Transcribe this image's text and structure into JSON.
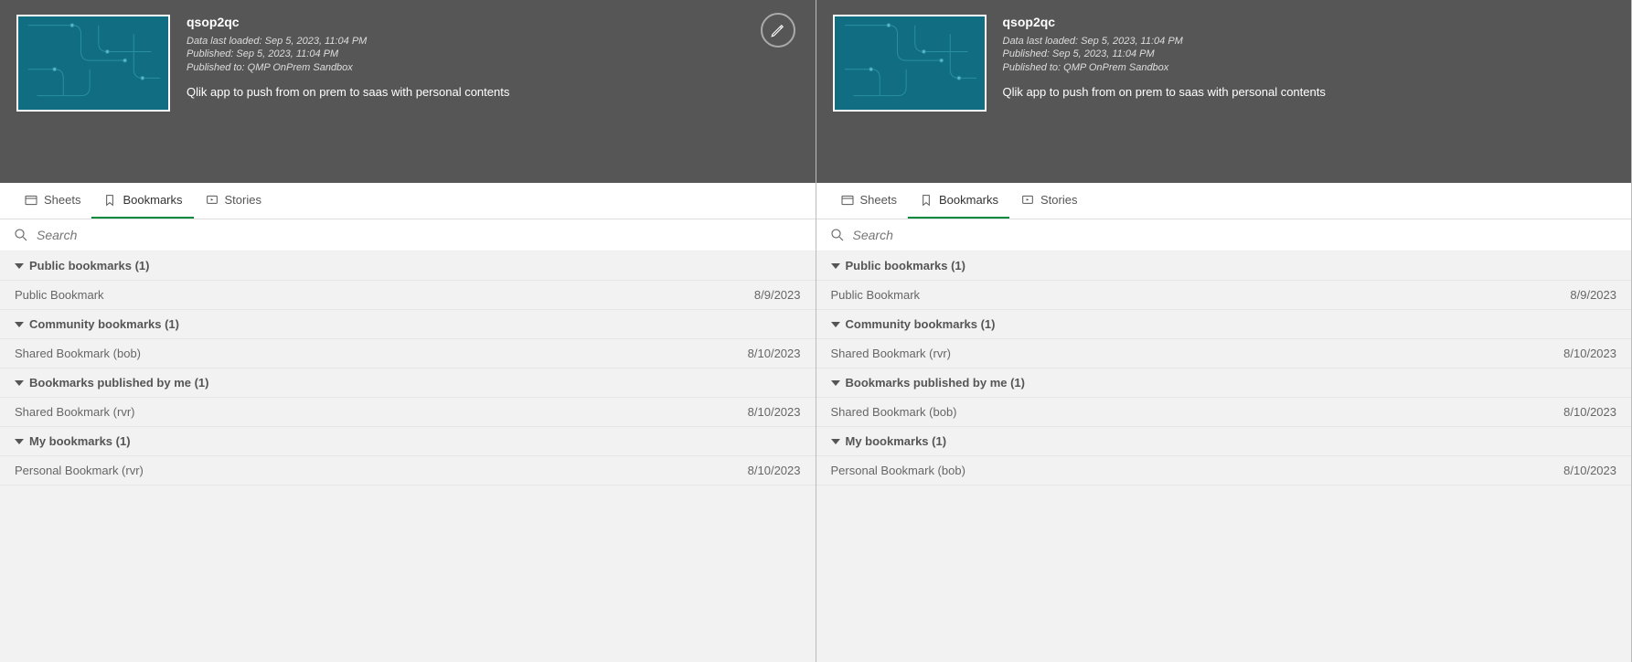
{
  "panels": [
    {
      "app_title": "qsop2qc",
      "loaded": "Data last loaded: Sep 5, 2023, 11:04 PM",
      "published": "Published: Sep 5, 2023, 11:04 PM",
      "published_to": "Published to: QMP OnPrem Sandbox",
      "desc": "Qlik app to push from on prem to saas with personal contents",
      "show_edit": true,
      "tabs": {
        "sheets": "Sheets",
        "bookmarks": "Bookmarks",
        "stories": "Stories"
      },
      "search_placeholder": "Search",
      "sections": [
        {
          "title": "Public bookmarks (1)",
          "items": [
            {
              "name": "Public Bookmark",
              "date": "8/9/2023"
            }
          ]
        },
        {
          "title": "Community bookmarks (1)",
          "items": [
            {
              "name": "Shared Bookmark (bob)",
              "date": "8/10/2023"
            }
          ]
        },
        {
          "title": "Bookmarks published by me (1)",
          "items": [
            {
              "name": "Shared Bookmark (rvr)",
              "date": "8/10/2023"
            }
          ]
        },
        {
          "title": "My bookmarks (1)",
          "items": [
            {
              "name": "Personal Bookmark (rvr)",
              "date": "8/10/2023"
            }
          ]
        }
      ]
    },
    {
      "app_title": "qsop2qc",
      "loaded": "Data last loaded: Sep 5, 2023, 11:04 PM",
      "published": "Published: Sep 5, 2023, 11:04 PM",
      "published_to": "Published to: QMP OnPrem Sandbox",
      "desc": "Qlik app to push from on prem to saas with personal contents",
      "show_edit": false,
      "tabs": {
        "sheets": "Sheets",
        "bookmarks": "Bookmarks",
        "stories": "Stories"
      },
      "search_placeholder": "Search",
      "sections": [
        {
          "title": "Public bookmarks (1)",
          "items": [
            {
              "name": "Public Bookmark",
              "date": "8/9/2023"
            }
          ]
        },
        {
          "title": "Community bookmarks (1)",
          "items": [
            {
              "name": "Shared Bookmark (rvr)",
              "date": "8/10/2023"
            }
          ]
        },
        {
          "title": "Bookmarks published by me (1)",
          "items": [
            {
              "name": "Shared Bookmark (bob)",
              "date": "8/10/2023"
            }
          ]
        },
        {
          "title": "My bookmarks (1)",
          "items": [
            {
              "name": "Personal Bookmark (bob)",
              "date": "8/10/2023"
            }
          ]
        }
      ]
    }
  ]
}
